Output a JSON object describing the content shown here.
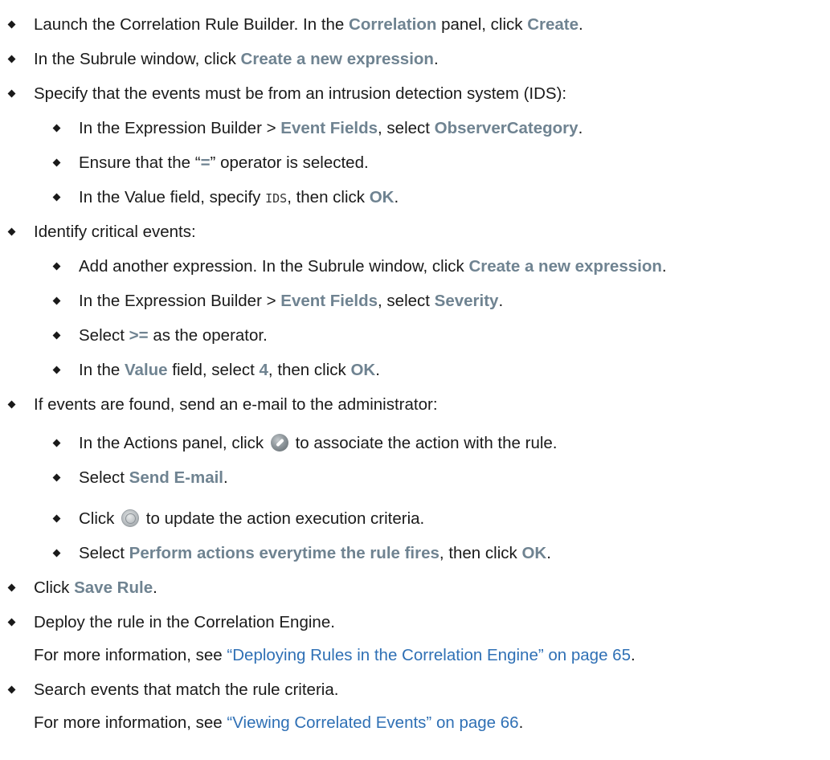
{
  "lines": {
    "l1": {
      "a": "Launch the Correlation Rule Builder. In the ",
      "b": "Correlation",
      "c": " panel, click ",
      "d": "Create",
      "e": "."
    },
    "l2": {
      "a": "In the Subrule window, click ",
      "b": "Create a new expression",
      "c": "."
    },
    "l3": {
      "a": "Specify that the events must be from an intrusion detection system (IDS):"
    },
    "l4": {
      "a": "In the Expression Builder > ",
      "b": "Event Fields",
      "c": ", select ",
      "d": "ObserverCategory",
      "e": "."
    },
    "l5": {
      "a": "Ensure that the “",
      "b": "=",
      "c": "” operator is selected."
    },
    "l6": {
      "a": "In the Value field, specify ",
      "b": "IDS",
      "c": ", then click ",
      "d": "OK",
      "e": "."
    },
    "l7": {
      "a": "Identify critical events:"
    },
    "l8": {
      "a": "Add another expression. In the Subrule window, click ",
      "b": "Create a new expression",
      "c": "."
    },
    "l9": {
      "a": "In the Expression Builder > ",
      "b": "Event Fields",
      "c": ", select ",
      "d": "Severity",
      "e": "."
    },
    "l10": {
      "a": "Select ",
      "b": ">=",
      "c": " as the operator."
    },
    "l11": {
      "a": "In the ",
      "b": "Value",
      "c": " field, select ",
      "d": "4",
      "e": ", then click ",
      "f": "OK",
      "g": "."
    },
    "l12": {
      "a": "If events are found, send an e-mail to the administrator:"
    },
    "l13": {
      "a": "In the Actions panel, click ",
      "icon": "action-wrench-icon",
      "b": " to associate the action with the rule."
    },
    "l14": {
      "a": "Select ",
      "b": "Send E-mail",
      "c": "."
    },
    "l15": {
      "a": "Click ",
      "icon": "criteria-clock-icon",
      "b": " to update the action execution criteria."
    },
    "l16": {
      "a": "Select ",
      "b": "Perform actions everytime the rule fires",
      "c": ", then click ",
      "d": "OK",
      "e": "."
    },
    "l17": {
      "a": "Click ",
      "b": "Save Rule",
      "c": "."
    },
    "l18": {
      "a": "Deploy the rule in the Correlation Engine."
    },
    "l19": {
      "a": "For more information, see ",
      "b": "“Deploying Rules in the Correlation Engine” on page 65",
      "c": "."
    },
    "l20": {
      "a": "Search events that match the rule criteria."
    },
    "l21": {
      "a": "For more information, see ",
      "b": "“Viewing Correlated Events” on page 66",
      "c": "."
    }
  },
  "colors": {
    "ui_term": "#6f8391",
    "xref_link": "#2f70b5",
    "text": "#1a1a1a"
  }
}
